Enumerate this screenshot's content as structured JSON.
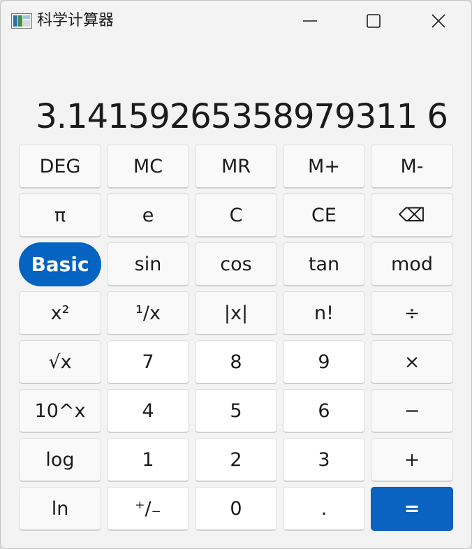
{
  "window": {
    "title": "科学计算器",
    "minimize_icon": "minimize-icon",
    "maximize_icon": "maximize-icon",
    "close_icon": "close-icon"
  },
  "display": {
    "value": "3.14159265358979311 6"
  },
  "keypad": {
    "rows": [
      [
        "DEG",
        "MC",
        "MR",
        "M+",
        "M-"
      ],
      [
        "π",
        "e",
        "C",
        "CE",
        "⌫"
      ],
      [
        "Basic",
        "sin",
        "cos",
        "tan",
        "mod"
      ],
      [
        "x²",
        "¹/x",
        "|x|",
        "n!",
        "÷"
      ],
      [
        "√x",
        "7",
        "8",
        "9",
        "×"
      ],
      [
        "10^x",
        "4",
        "5",
        "6",
        "−"
      ],
      [
        "log",
        "1",
        "2",
        "3",
        "+"
      ],
      [
        "ln",
        "⁺/₋",
        "0",
        ".",
        "="
      ]
    ]
  },
  "colors": {
    "accent": "#0563c1",
    "window_bg": "#f3f3f3",
    "key_bg": "#f9f9f9",
    "digit_bg": "#ffffff"
  }
}
